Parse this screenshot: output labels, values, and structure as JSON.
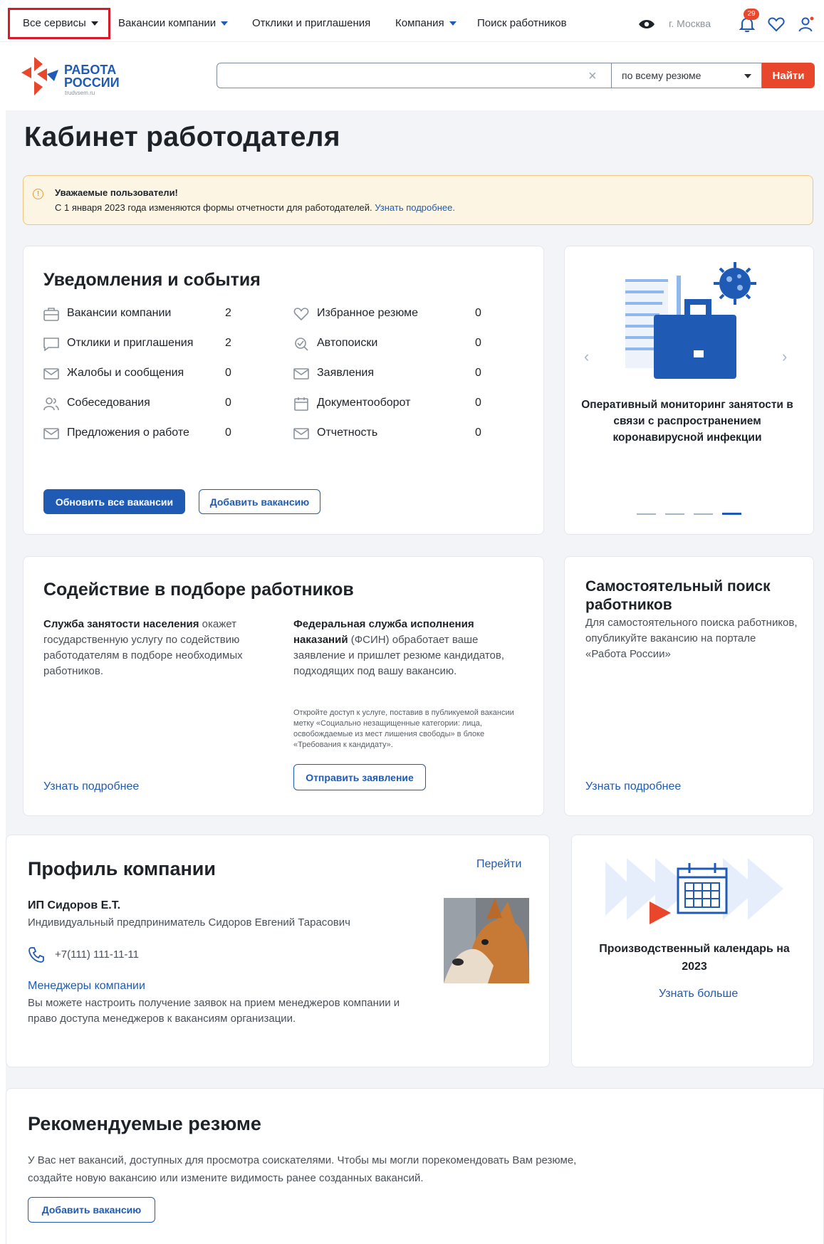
{
  "topnav": {
    "items": [
      {
        "label": "Все сервисы",
        "dropdown": true
      },
      {
        "label": "Вакансии компании",
        "dropdown": true
      },
      {
        "label": "Отклики и приглашения",
        "dropdown": false
      },
      {
        "label": "Компания",
        "dropdown": true
      },
      {
        "label": "Поиск работников",
        "dropdown": false
      }
    ],
    "city": "г. Москва",
    "notifications_count": "29",
    "icons": [
      "eye-icon",
      "bell-icon",
      "heart-icon",
      "user-icon"
    ]
  },
  "header": {
    "logo_line1": "РАБОТА",
    "logo_line2": "РОССИИ",
    "logo_sub": "trudvsem.ru",
    "search_placeholder": "",
    "search_scope": "по всему резюме",
    "search_button": "Найти"
  },
  "page_title": "Кабинет работодателя",
  "notice": {
    "title": "Уважаемые пользователи!",
    "text": "С 1 января 2023 года изменяются формы отчетности для работодателей.",
    "link": "Узнать подробнее."
  },
  "notifications": {
    "title": "Уведомления и события",
    "left": [
      {
        "label": "Вакансии компании",
        "value": "2",
        "icon": "briefcase-icon"
      },
      {
        "label": "Отклики и приглашения",
        "value": "2",
        "icon": "chat-icon"
      },
      {
        "label": "Жалобы и сообщения",
        "value": "0",
        "icon": "mail-icon"
      },
      {
        "label": "Собеседования",
        "value": "0",
        "icon": "users-icon"
      },
      {
        "label": "Предложения о работе",
        "value": "0",
        "icon": "mail-icon"
      }
    ],
    "right": [
      {
        "label": "Избранное резюме",
        "value": "0",
        "icon": "heart-icon"
      },
      {
        "label": "Автопоиски",
        "value": "0",
        "icon": "search-check-icon"
      },
      {
        "label": "Заявления",
        "value": "0",
        "icon": "mail-icon"
      },
      {
        "label": "Документооборот",
        "value": "0",
        "icon": "calendar-icon"
      },
      {
        "label": "Отчетность",
        "value": "0",
        "icon": "mail-icon"
      }
    ],
    "update_button": "Обновить все вакансии",
    "add_button": "Добавить вакансию"
  },
  "carousel": {
    "caption": "Оперативный мониторинг занятости в связи с распространением коронавирусной инфекции",
    "active_slide": 4,
    "slides": 4,
    "colors": {
      "accent": "#1f5bb4",
      "light": "#8fb8ee"
    }
  },
  "assistance": {
    "title": "Содействие в подборе работников",
    "left_bold": "Служба занятости населения",
    "left_text": " окажет государственную услугу по содействию работодателям в подборе необходимых работников.",
    "left_link": "Узнать подробнее",
    "right_bold": "Федеральная служба исполнения наказаний",
    "right_text": " (ФСИН) обработает ваше заявление и пришлет резюме кандидатов, подходящих под вашу вакансию.",
    "right_small": "Откройте доступ к услуге, поставив в публикуемой вакансии метку «Социально незащищенные категории: лица, освобождаемые из мест лишения свободы» в блоке «Требования к кандидату».",
    "right_button": "Отправить заявление"
  },
  "self_search": {
    "title": "Самостоятельный поиск работников",
    "text": "Для самостоятельного поиска работников, опубликуйте вакансию на портале «Работа России»",
    "link": "Узнать подробнее"
  },
  "profile": {
    "title": "Профиль компании",
    "goto": "Перейти",
    "company_short": "ИП Сидоров Е.Т.",
    "company_full": "Индивидуальный предприниматель Сидоров Евгений Тарасович",
    "phone": "+7(111) 111-11-11",
    "managers_link": "Менеджеры компании",
    "managers_text": "Вы можете настроить получение заявок на прием менеджеров компании и право доступа менеджеров к вакансиям организации."
  },
  "calendar": {
    "title": "Производственный календарь на 2023",
    "link": "Узнать больше"
  },
  "recommended": {
    "title": "Рекомендуемые резюме",
    "text": "У Вас нет вакансий, доступных для просмотра соискателями. Чтобы мы могли порекомендовать Вам резюме, создайте новую вакансию или измените видимость ранее созданных вакансий.",
    "button": "Добавить вакансию"
  }
}
